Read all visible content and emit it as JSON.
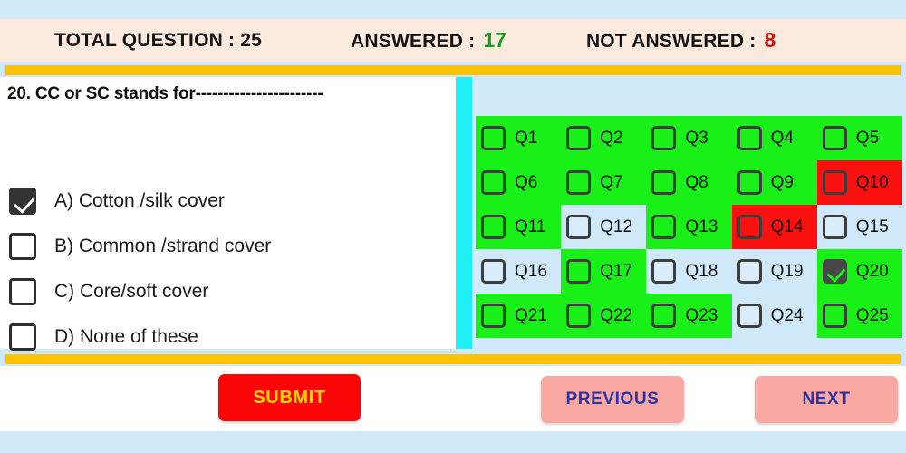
{
  "header": {
    "total_label": "TOTAL QUESTION : 25",
    "answered_label": "ANSWERED :",
    "answered_value": "17",
    "not_answered_label": "NOT ANSWERED :",
    "not_answered_value": "8",
    "answered_color": "#17a11b",
    "not_answered_color": "#d01010",
    "background": "#fdeade"
  },
  "divider": {
    "color": "#fcc203"
  },
  "question": {
    "text": "20. CC or SC stands for-----------------------",
    "number": "20",
    "options": [
      {
        "label": "A) Cotton /silk cover",
        "checked": true
      },
      {
        "label": "B) Common /strand cover",
        "checked": false
      },
      {
        "label": "C) Core/soft cover",
        "checked": false
      },
      {
        "label": "D) None of these",
        "checked": false
      }
    ]
  },
  "palette": {
    "colors": {
      "answered": "#18f018",
      "marked": "#fb1010",
      "not_answered": "#cfe9fa"
    },
    "cells": [
      {
        "label": "Q1",
        "state": "green",
        "checked": false
      },
      {
        "label": "Q2",
        "state": "green",
        "checked": false
      },
      {
        "label": "Q3",
        "state": "green",
        "checked": false
      },
      {
        "label": "Q4",
        "state": "green",
        "checked": false
      },
      {
        "label": "Q5",
        "state": "green",
        "checked": false
      },
      {
        "label": "Q6",
        "state": "green",
        "checked": false
      },
      {
        "label": "Q7",
        "state": "green",
        "checked": false
      },
      {
        "label": "Q8",
        "state": "green",
        "checked": false
      },
      {
        "label": "Q9",
        "state": "green",
        "checked": false
      },
      {
        "label": "Q10",
        "state": "red",
        "checked": false
      },
      {
        "label": "Q11",
        "state": "green",
        "checked": false
      },
      {
        "label": "Q12",
        "state": "blue",
        "checked": false
      },
      {
        "label": "Q13",
        "state": "green",
        "checked": false
      },
      {
        "label": "Q14",
        "state": "red",
        "checked": false
      },
      {
        "label": "Q15",
        "state": "blue",
        "checked": false
      },
      {
        "label": "Q16",
        "state": "blue",
        "checked": false
      },
      {
        "label": "Q17",
        "state": "green",
        "checked": false
      },
      {
        "label": "Q18",
        "state": "blue",
        "checked": false
      },
      {
        "label": "Q19",
        "state": "blue",
        "checked": false
      },
      {
        "label": "Q20",
        "state": "green",
        "checked": true
      },
      {
        "label": "Q21",
        "state": "green",
        "checked": false
      },
      {
        "label": "Q22",
        "state": "green",
        "checked": false
      },
      {
        "label": "Q23",
        "state": "green",
        "checked": false
      },
      {
        "label": "Q24",
        "state": "blue",
        "checked": false
      },
      {
        "label": "Q25",
        "state": "green",
        "checked": false
      }
    ]
  },
  "footer": {
    "submit_label": "SUBMIT",
    "previous_label": "PREVIOUS",
    "next_label": "NEXT",
    "submit_bg": "#fb0606",
    "submit_fg": "#ffd400",
    "nav_bg": "#f9a8a2",
    "nav_fg": "#2a34a8"
  }
}
